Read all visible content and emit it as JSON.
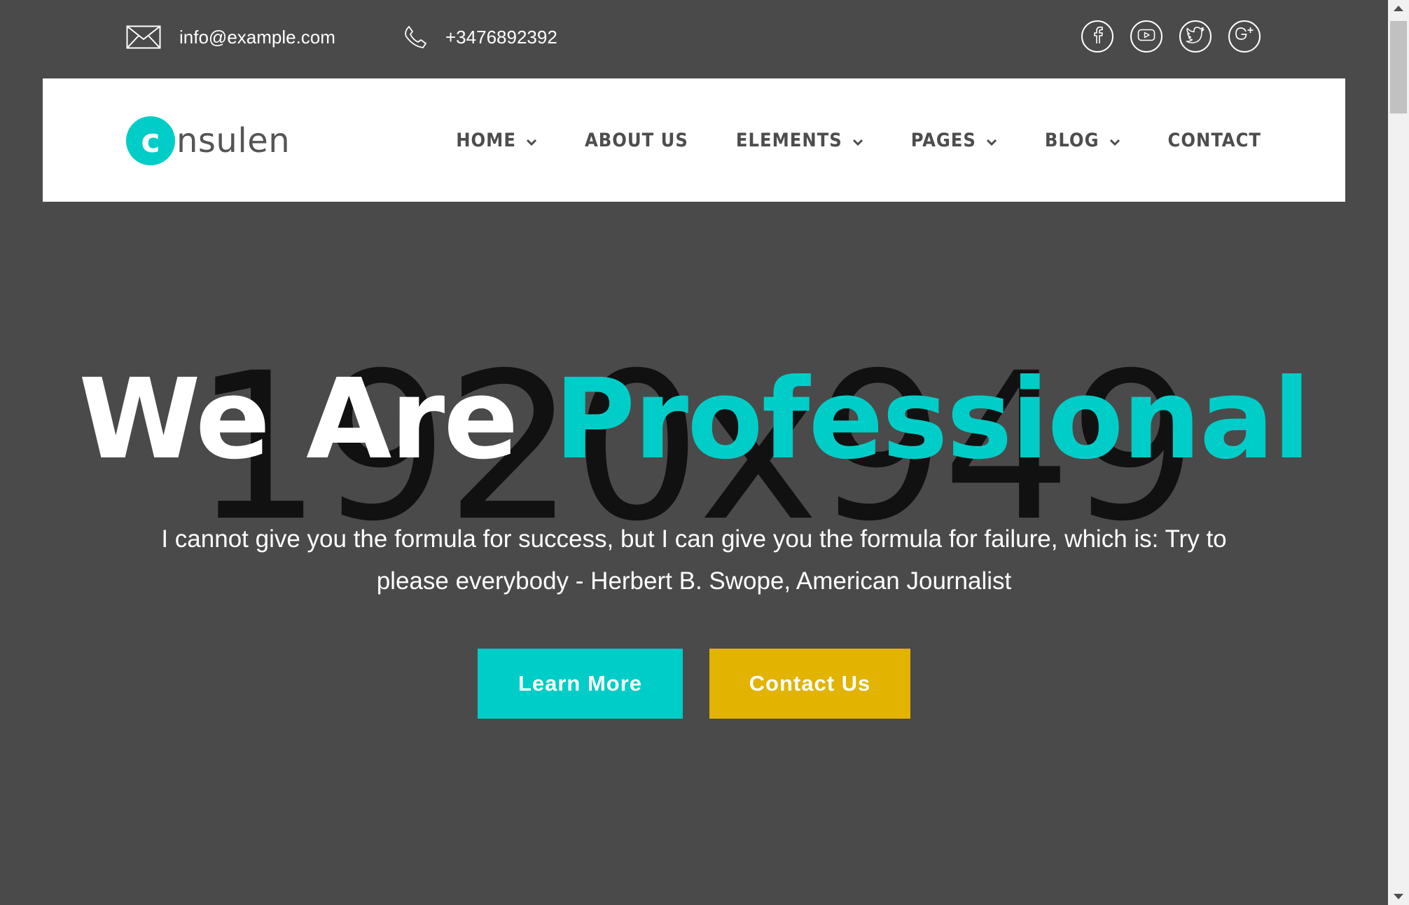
{
  "topbar": {
    "email": "info@example.com",
    "phone": "+3476892392",
    "socials": [
      "facebook-icon",
      "youtube-icon",
      "twitter-icon",
      "google-plus-icon"
    ]
  },
  "nav": {
    "logo_mark": "c",
    "logo_text": "nsulen",
    "items": [
      {
        "label": "HOME",
        "dropdown": true
      },
      {
        "label": "ABOUT US",
        "dropdown": false
      },
      {
        "label": "ELEMENTS",
        "dropdown": true
      },
      {
        "label": "PAGES",
        "dropdown": true
      },
      {
        "label": "BLOG",
        "dropdown": true
      },
      {
        "label": "CONTACT",
        "dropdown": false
      }
    ]
  },
  "hero": {
    "placeholder": "1920x949",
    "title_part1": "We Are",
    "title_part2": "Professional",
    "quote": "I cannot give you the formula for success, but I can give you the formula for failure, which is: Try to please everybody - Herbert B. Swope, American Journalist",
    "learn_more_label": "Learn More",
    "contact_label": "Contact Us"
  },
  "colors": {
    "background": "#4a4a4a",
    "accent": "#00cdc7",
    "secondary_button": "#e2b300",
    "nav_text": "#4d4d4d"
  }
}
